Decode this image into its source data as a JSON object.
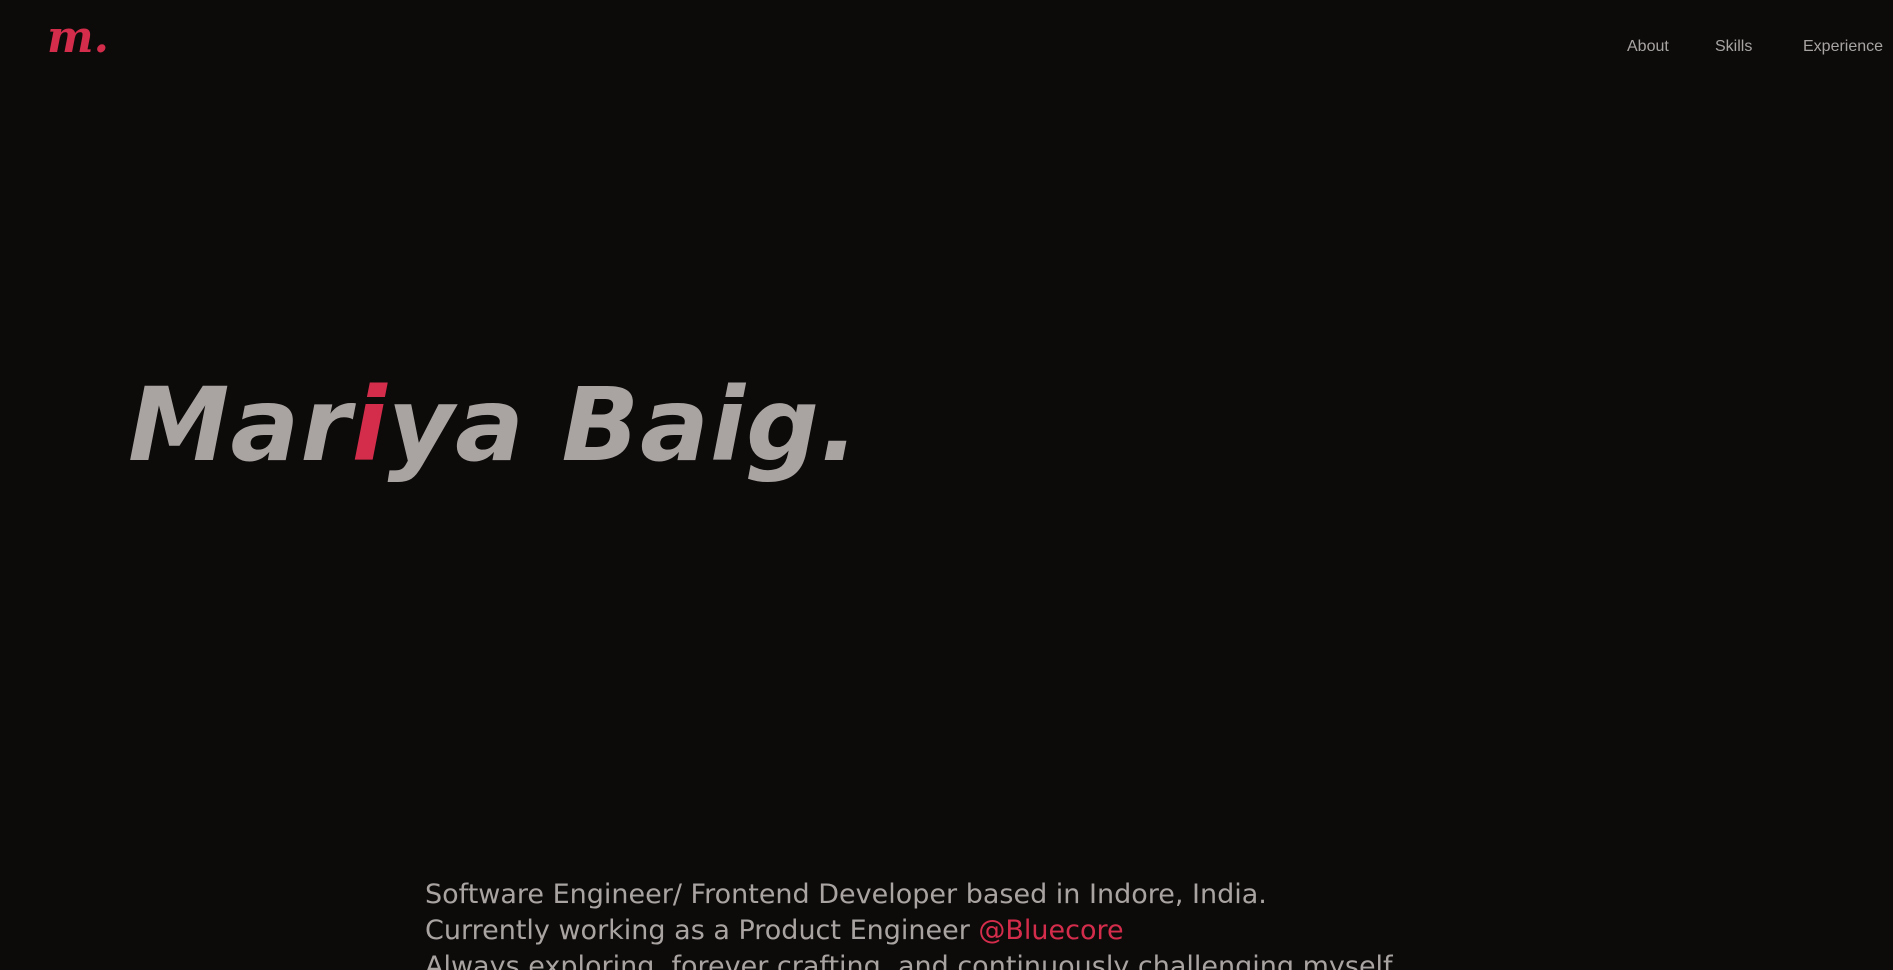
{
  "header": {
    "logo_text": "m",
    "logo_dot": ".",
    "nav": {
      "about": "About",
      "skills": "Skills",
      "experience": "Experience"
    }
  },
  "hero": {
    "name_part1": "Mar",
    "name_accent": "i",
    "name_part2": "ya Baig."
  },
  "intro": {
    "line1": "Software Engineer/ Frontend Developer based in Indore, India.",
    "line2_prefix": "Currently working as a Product Engineer ",
    "line2_link": "@Bluecore",
    "line3": "Always exploring, forever crafting, and continuously challenging myself."
  },
  "colors": {
    "background": "#0c0b0a",
    "text": "#a9a4a2",
    "accent": "#d42c4b"
  }
}
